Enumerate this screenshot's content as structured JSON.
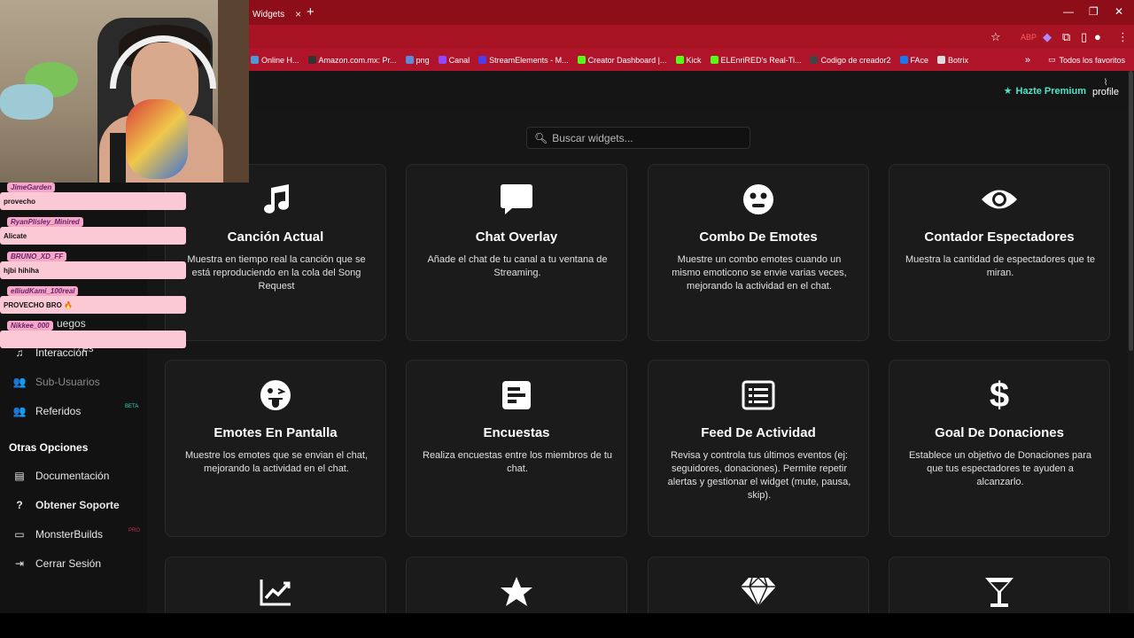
{
  "browser": {
    "tab_title": "Widgets",
    "tab_close": "×",
    "new_tab": "+",
    "window_controls": [
      "—",
      "❐",
      "✕"
    ],
    "bookmarks": [
      {
        "label": "Online H...",
        "color": "#4a9bd8"
      },
      {
        "label": "Amazon.com.mx: Pr...",
        "color": "#333333"
      },
      {
        "label": "png",
        "color": "#5a8cd8"
      },
      {
        "label": "Canal",
        "color": "#9146ff"
      },
      {
        "label": "StreamElements - M...",
        "color": "#4b3df0"
      },
      {
        "label": "Creator Dashboard |...",
        "color": "#53fc18"
      },
      {
        "label": "Kick",
        "color": "#53fc18"
      },
      {
        "label": "ELEnriRED's Real-Ti...",
        "color": "#53fc18"
      },
      {
        "label": "Codigo de creador2",
        "color": "#444444"
      },
      {
        "label": "FAce",
        "color": "#1877f2"
      },
      {
        "label": "Botrix",
        "color": "#dddddd"
      }
    ],
    "bookmarks_more": "»",
    "all_favorites": "Todos los favoritos"
  },
  "header": {
    "premium_label": "Hazte Premium",
    "profile_label": "profile"
  },
  "search": {
    "placeholder": "Buscar widgets..."
  },
  "sidebar": {
    "items": [
      {
        "label": "Interacción",
        "icon": "music-icon"
      },
      {
        "label": "Sub-Usuarios",
        "icon": "users-icon"
      },
      {
        "label": "Referidos",
        "icon": "users-icon",
        "badge": "BETA"
      }
    ],
    "partial_labels": [
      "es",
      "uegos"
    ],
    "other_heading": "Otras Opciones",
    "other_items": [
      {
        "label": "Documentación",
        "icon": "book-icon"
      },
      {
        "label": "Obtener Soporte",
        "icon": "question-icon"
      },
      {
        "label": "MonsterBuilds",
        "icon": "laptop-icon",
        "badge": "PRO"
      },
      {
        "label": "Cerrar Sesión",
        "icon": "logout-icon"
      }
    ]
  },
  "cards": [
    {
      "title": "Canción Actual",
      "desc": "Muestra en tiempo real la canción que se está reproduciendo en la cola del Song Request",
      "icon": "music-note-icon"
    },
    {
      "title": "Chat Overlay",
      "desc": "Añade el chat de tu canal a tu ventana de Streaming.",
      "icon": "chat-bubble-icon"
    },
    {
      "title": "Combo De Emotes",
      "desc": "Muestre un combo emotes cuando un mismo emoticono se envie varias veces, mejorando la actividad en el chat.",
      "icon": "surprised-face-icon"
    },
    {
      "title": "Contador Espectadores",
      "desc": "Muestra la cantidad de espectadores que te miran.",
      "icon": "eye-icon"
    },
    {
      "title": "Emotes En Pantalla",
      "desc": "Muestre los emotes que se envian el chat, mejorando la actividad en el chat.",
      "icon": "tongue-face-icon"
    },
    {
      "title": "Encuestas",
      "desc": "Realiza encuestas entre los miembros de tu chat.",
      "icon": "poll-icon"
    },
    {
      "title": "Feed De Actividad",
      "desc": "Revisa y controla tus últimos eventos (ej: seguidores, donaciones). Permite repetir alertas y gestionar el widget (mute, pausa, skip).",
      "icon": "list-icon"
    },
    {
      "title": "Goal De Donaciones",
      "desc": "Establece un objetivo de Donaciones para que tus espectadores te ayuden a alcanzarlo.",
      "icon": "dollar-icon"
    }
  ],
  "chat_overlay": [
    {
      "user": "JimeGarden",
      "message": "provecho"
    },
    {
      "user": "RyanPlisley_Minired",
      "message": "Alicate"
    },
    {
      "user": "BRUNO_XD_FF",
      "message": "hjbi hihiha"
    },
    {
      "user": "elliudKami_100real",
      "message": "PROVECHO BRO 🔥"
    },
    {
      "user": "Nikkee_000",
      "message": ""
    }
  ]
}
